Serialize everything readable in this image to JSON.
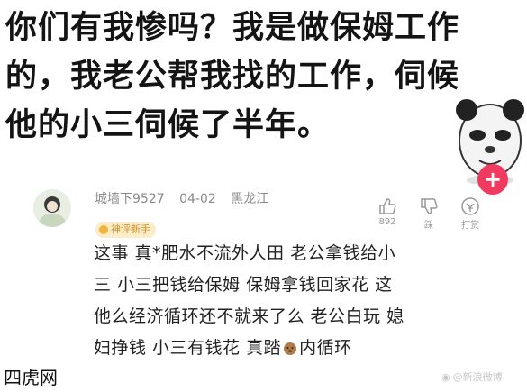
{
  "headline": {
    "lines": [
      "你们有我惨吗？我是做保姆工作",
      "的，我老公帮我找的工作，伺候",
      "他的小三伺候了半年。"
    ]
  },
  "comment": {
    "username": "城墙下9527",
    "date": "04-02",
    "location": "黑龙江",
    "badge": "神评新手",
    "likes": "892",
    "dislike_label": "踩",
    "share_label": "打赏",
    "text_lines": [
      "这事  真*肥水不流外人田   老公拿钱给小",
      "三 小三把钱给保姆   保姆拿钱回家花   这",
      "他么经济循环还不就来了么   老公白玩  媳",
      "妇挣钱 小三有钱花  真踏",
      "内循环"
    ]
  },
  "fab_label": "+",
  "watermark": {
    "site": "四虎网",
    "user": "@新浪微博"
  },
  "colors": {
    "fab": "#f03a5f",
    "badge_bg": "#fdecc9",
    "badge_text": "#c9922b",
    "meta": "#8a8a8a"
  }
}
